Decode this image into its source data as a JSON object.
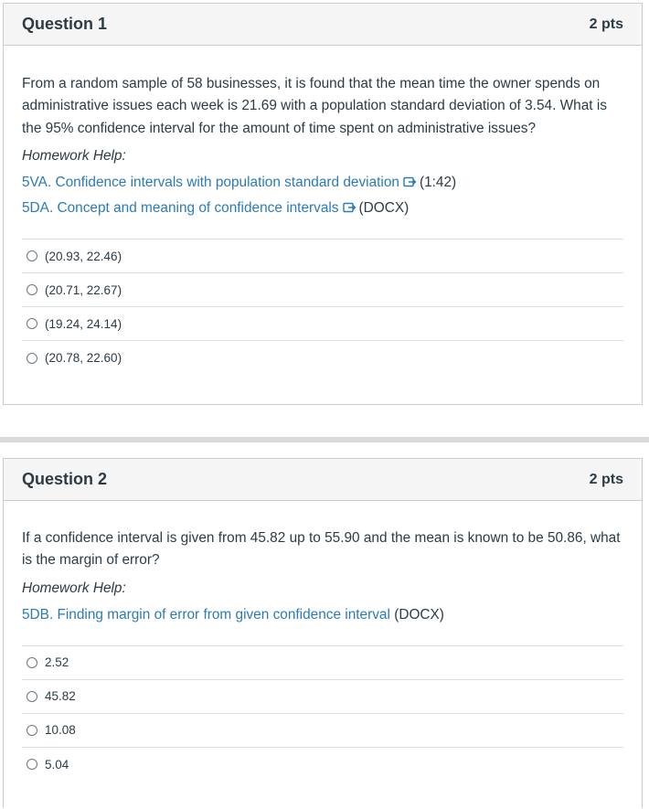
{
  "question1": {
    "title": "Question 1",
    "points": "2 pts",
    "text": "From a random sample of 58 businesses, it is found that the mean time the owner spends on administrative issues each week is 21.69 with a population standard deviation of 3.54. What is the 95% confidence interval for the amount of time spent on administrative issues?",
    "homework_help": "Homework Help:",
    "links": [
      {
        "label": "5VA. Confidence intervals with population standard deviation",
        "suffix": "(1:42)",
        "icon": "external-link-icon"
      },
      {
        "label": "5DA. Concept and meaning of confidence intervals",
        "suffix": "(DOCX)",
        "icon": "external-link-icon"
      }
    ],
    "answers": [
      "(20.93, 22.46)",
      "(20.71, 22.67)",
      "(19.24, 24.14)",
      "(20.78, 22.60)"
    ]
  },
  "question2": {
    "title": "Question 2",
    "points": "2 pts",
    "text": "If a confidence interval is given from 45.82 up to 55.90 and the mean is known to be 50.86, what is the margin of error?",
    "homework_help": "Homework Help:",
    "links": [
      {
        "label": "5DB. Finding margin of error from given confidence interval",
        "suffix": "(DOCX)"
      }
    ],
    "answers": [
      "2.52",
      "45.82",
      "10.08",
      "5.04"
    ]
  },
  "colors": {
    "link": "#2c7bb6",
    "text": "#2d3b45",
    "header_bg": "#f5f5f5",
    "border": "#c7cdd1"
  }
}
